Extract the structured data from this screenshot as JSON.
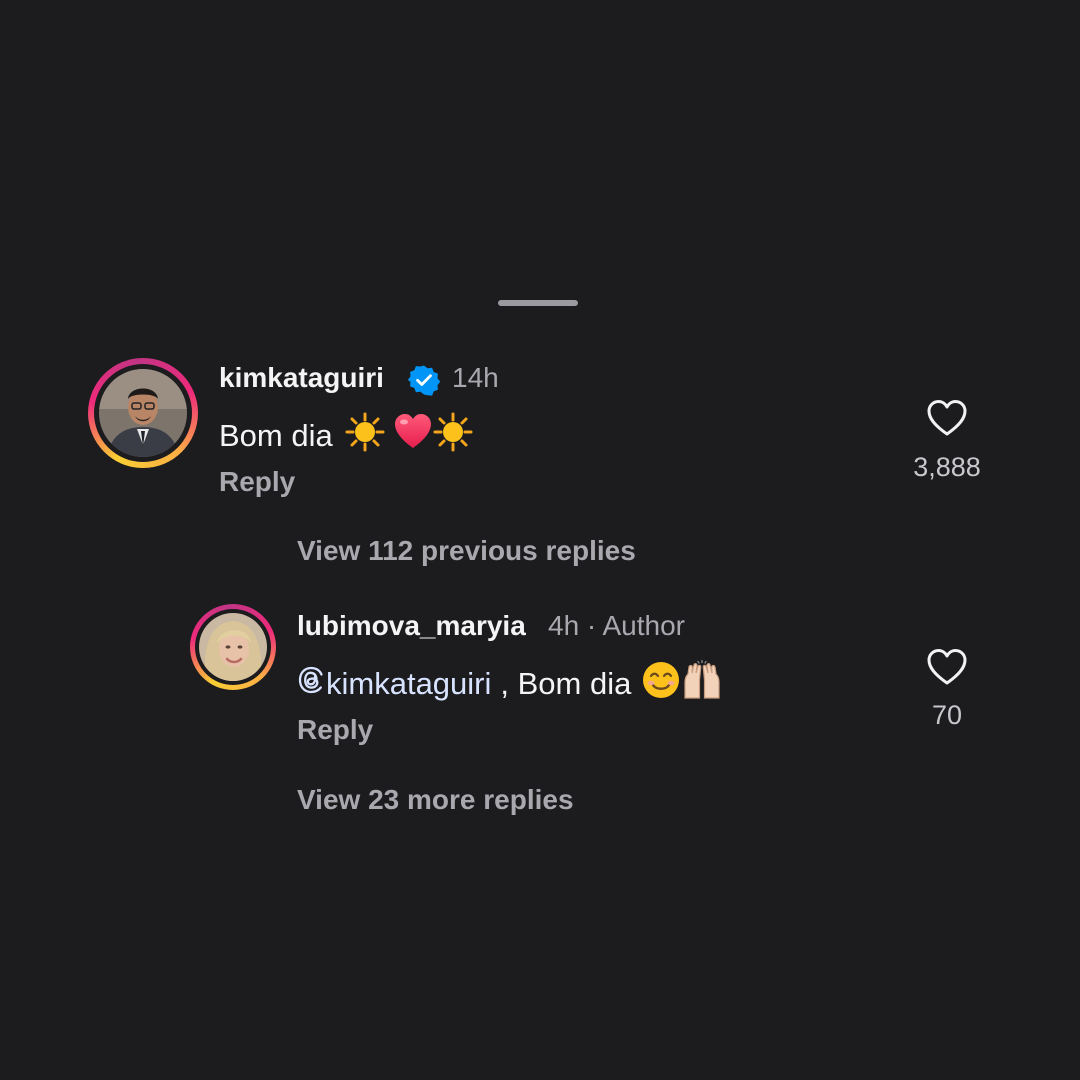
{
  "comments": [
    {
      "username": "kimkataguiri",
      "verified": true,
      "time": "14h",
      "text": "Bom dia",
      "emojis": [
        "sun-emoji",
        "red-heart-emoji",
        "sun-emoji"
      ],
      "reply_label": "Reply",
      "likes": "3,888"
    },
    {
      "username": "lubimova_maryia",
      "meta": "4h · Author",
      "mention": "kimkataguiri",
      "text": ", Bom dia",
      "emojis": [
        "smiling-face-emoji",
        "raising-hands-emoji"
      ],
      "reply_label": "Reply",
      "likes": "70"
    }
  ],
  "view_previous": "View 112 previous replies",
  "view_more": "View 23 more replies",
  "colors": {
    "background": "#1c1c1f",
    "secondary_text": "#a8a8ae",
    "verified_badge": "#0095f6"
  }
}
